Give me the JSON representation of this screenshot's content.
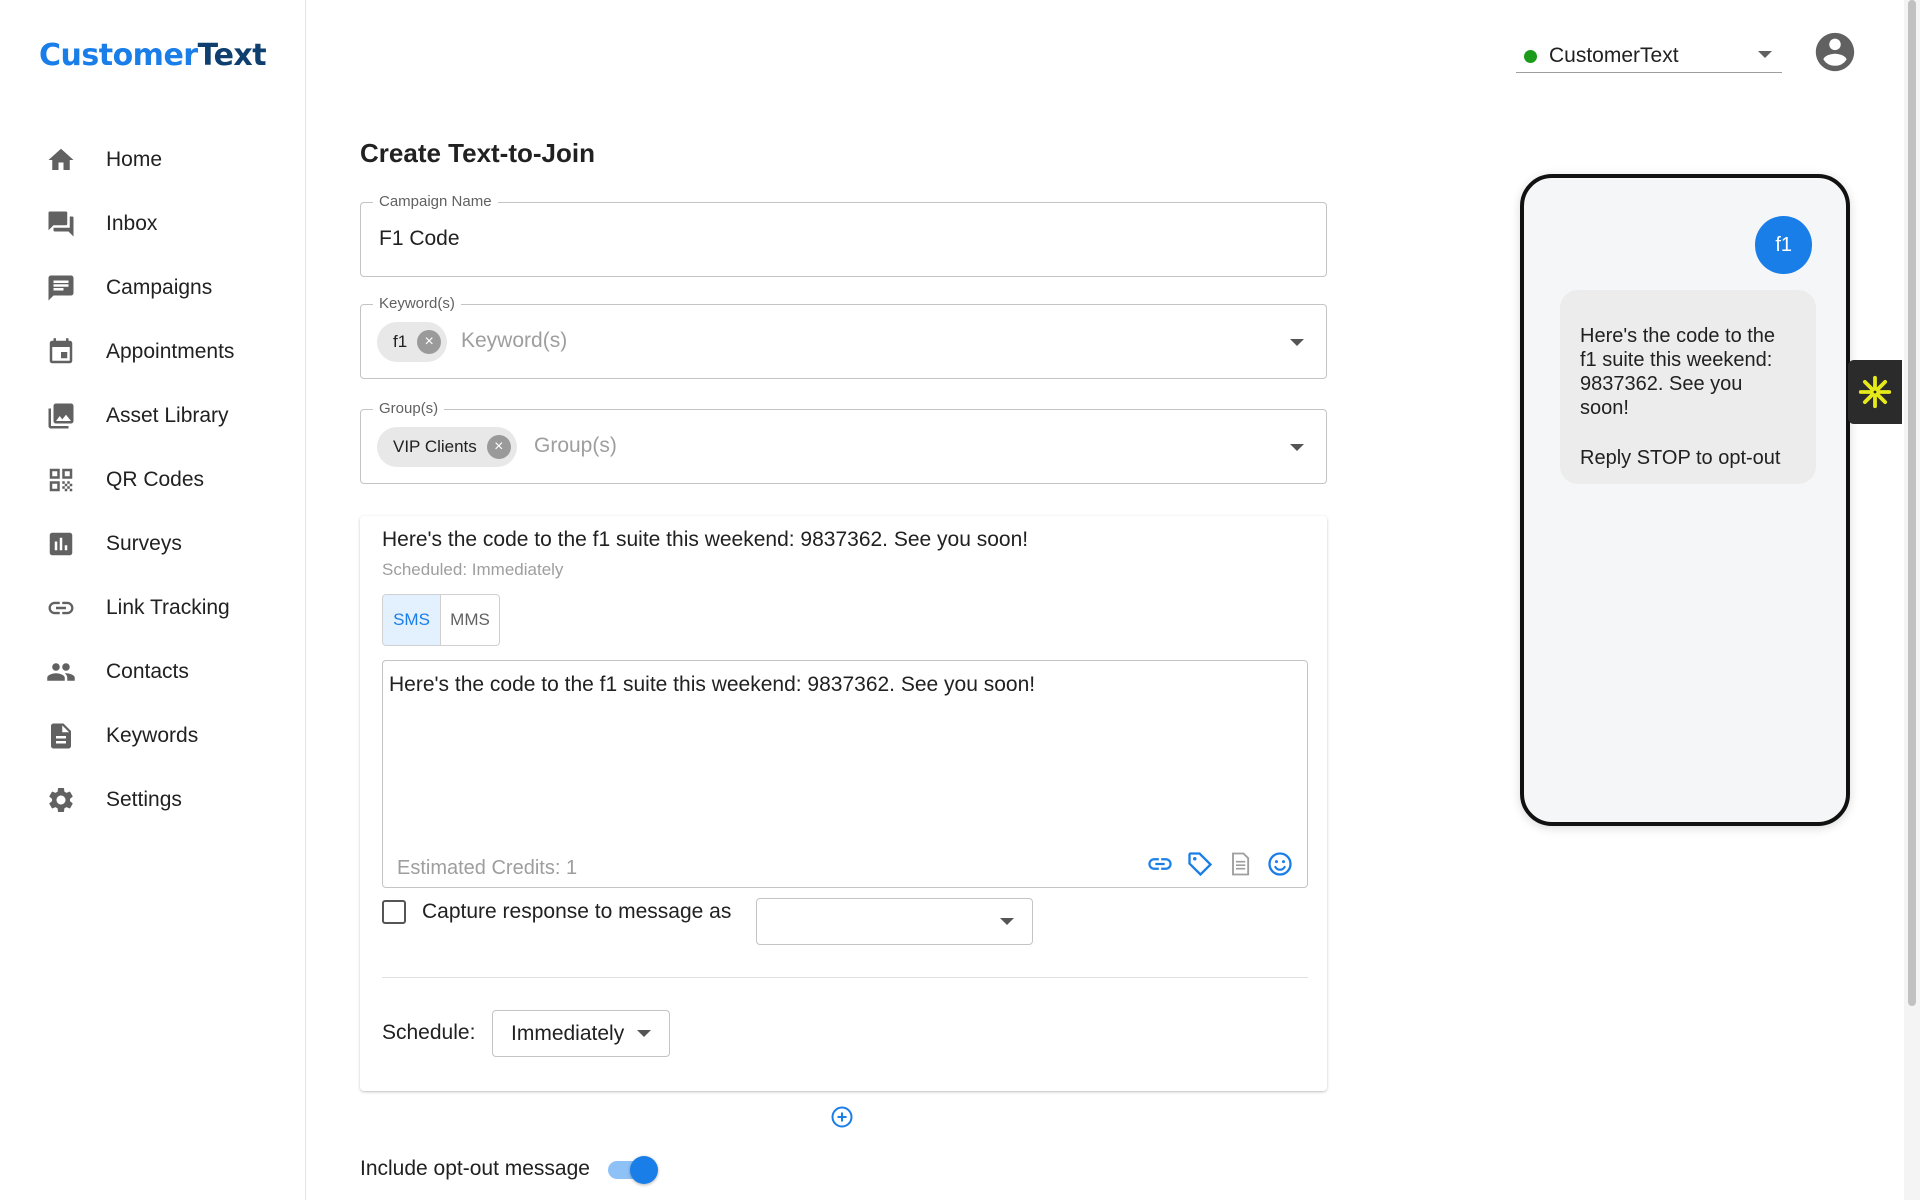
{
  "brand": {
    "part1": "Customer",
    "part2": "Text"
  },
  "sidebar": {
    "items": [
      {
        "label": "Home",
        "icon": "home-icon"
      },
      {
        "label": "Inbox",
        "icon": "inbox-icon"
      },
      {
        "label": "Campaigns",
        "icon": "campaigns-icon"
      },
      {
        "label": "Appointments",
        "icon": "calendar-icon"
      },
      {
        "label": "Asset Library",
        "icon": "photo-library-icon"
      },
      {
        "label": "QR Codes",
        "icon": "qr-code-icon"
      },
      {
        "label": "Surveys",
        "icon": "bar-chart-icon"
      },
      {
        "label": "Link Tracking",
        "icon": "link-icon"
      },
      {
        "label": "Contacts",
        "icon": "contacts-icon"
      },
      {
        "label": "Keywords",
        "icon": "document-icon"
      },
      {
        "label": "Settings",
        "icon": "gear-icon"
      }
    ]
  },
  "header": {
    "account_name": "CustomerText",
    "status_color": "#1a9b1a"
  },
  "page": {
    "title": "Create Text-to-Join"
  },
  "form": {
    "campaign_name": {
      "label": "Campaign Name",
      "value": "F1 Code"
    },
    "keywords": {
      "label": "Keyword(s)",
      "chips": [
        "f1"
      ],
      "placeholder": "Keyword(s)"
    },
    "groups": {
      "label": "Group(s)",
      "chips": [
        "VIP Clients"
      ],
      "placeholder": "Group(s)"
    }
  },
  "message": {
    "preview_text": "Here's the code to the f1 suite this weekend: 9837362. See you soon!",
    "scheduled_note": "Scheduled: Immediately",
    "type_options": [
      "SMS",
      "MMS"
    ],
    "selected_type": "SMS",
    "body": "Here's the code to the f1 suite this weekend: 9837362. See you soon!",
    "credits": "Estimated Credits: 1",
    "tools": [
      "link-icon",
      "tag-icon",
      "template-icon",
      "emoji-icon"
    ],
    "capture_label": "Capture response to message as",
    "capture_checked": false,
    "capture_value": "",
    "schedule_label": "Schedule:",
    "schedule_value": "Immediately"
  },
  "optout": {
    "label": "Include opt-out message",
    "enabled": true
  },
  "phone_preview": {
    "outgoing": "f1",
    "reply": "Here's the code to the f1 suite this weekend: 9837362. See you soon!",
    "stop_text": "Reply STOP to opt-out"
  },
  "colors": {
    "accent": "#1a7ee8",
    "brand_dark": "#0f3f6e",
    "widget_star": "#e6e91a"
  }
}
